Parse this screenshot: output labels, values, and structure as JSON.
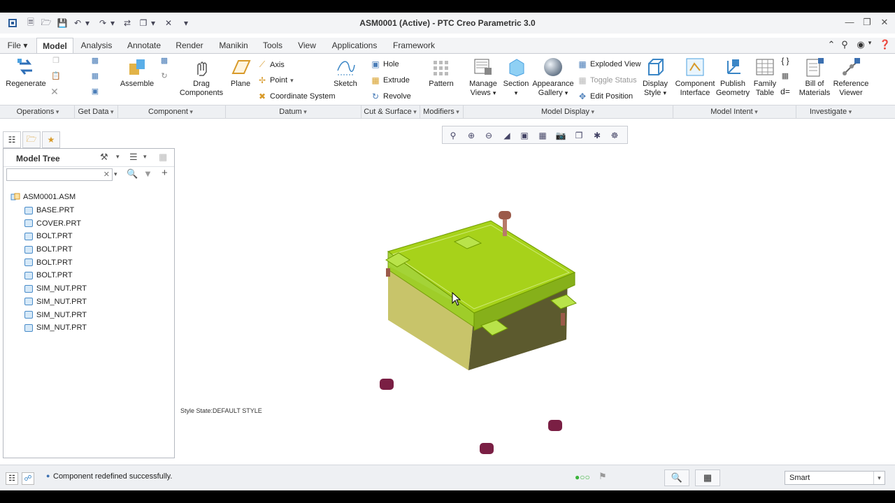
{
  "window": {
    "title": "ASM0001 (Active) - PTC Creo Parametric 3.0"
  },
  "tabs": [
    "File",
    "Model",
    "Analysis",
    "Annotate",
    "Render",
    "Manikin",
    "Tools",
    "View",
    "Applications",
    "Framework"
  ],
  "ribbon": {
    "regenerate": "Regenerate",
    "assemble": "Assemble",
    "drag_components": [
      "Drag",
      "Components"
    ],
    "plane": "Plane",
    "axis": "Axis",
    "point": "Point",
    "coordinate_system": "Coordinate System",
    "sketch": "Sketch",
    "hole": "Hole",
    "extrude": "Extrude",
    "revolve": "Revolve",
    "pattern": "Pattern",
    "manage_views": [
      "Manage",
      "Views"
    ],
    "section": "Section",
    "appearance_gallery": [
      "Appearance",
      "Gallery"
    ],
    "exploded_view": "Exploded View",
    "toggle_status": "Toggle Status",
    "edit_position": "Edit Position",
    "display_style": [
      "Display",
      "Style"
    ],
    "component_interface": [
      "Component",
      "Interface"
    ],
    "publish_geometry": [
      "Publish",
      "Geometry"
    ],
    "family_table": [
      "Family",
      "Table"
    ],
    "bill_of_materials": [
      "Bill of",
      "Materials"
    ],
    "reference_viewer": [
      "Reference",
      "Viewer"
    ]
  },
  "groups": [
    "Operations",
    "Get Data",
    "Component",
    "Datum",
    "Cut & Surface",
    "Modifiers",
    "Model Display",
    "Model Intent",
    "Investigate"
  ],
  "model_tree": {
    "title": "Model Tree",
    "root": "ASM0001.ASM",
    "items": [
      "BASE.PRT",
      "COVER.PRT",
      "BOLT.PRT",
      "BOLT.PRT",
      "BOLT.PRT",
      "BOLT.PRT",
      "SIM_NUT.PRT",
      "SIM_NUT.PRT",
      "SIM_NUT.PRT",
      "SIM_NUT.PRT"
    ]
  },
  "viewport": {
    "style_state": "Style State:DEFAULT STYLE"
  },
  "status": {
    "message": "Component redefined successfully.",
    "filter": "Smart"
  },
  "colors": {
    "cover": "#a7d21a",
    "base": "#c8c46a",
    "bolt": "#9b5a4a",
    "nut": "#7a1f44"
  }
}
